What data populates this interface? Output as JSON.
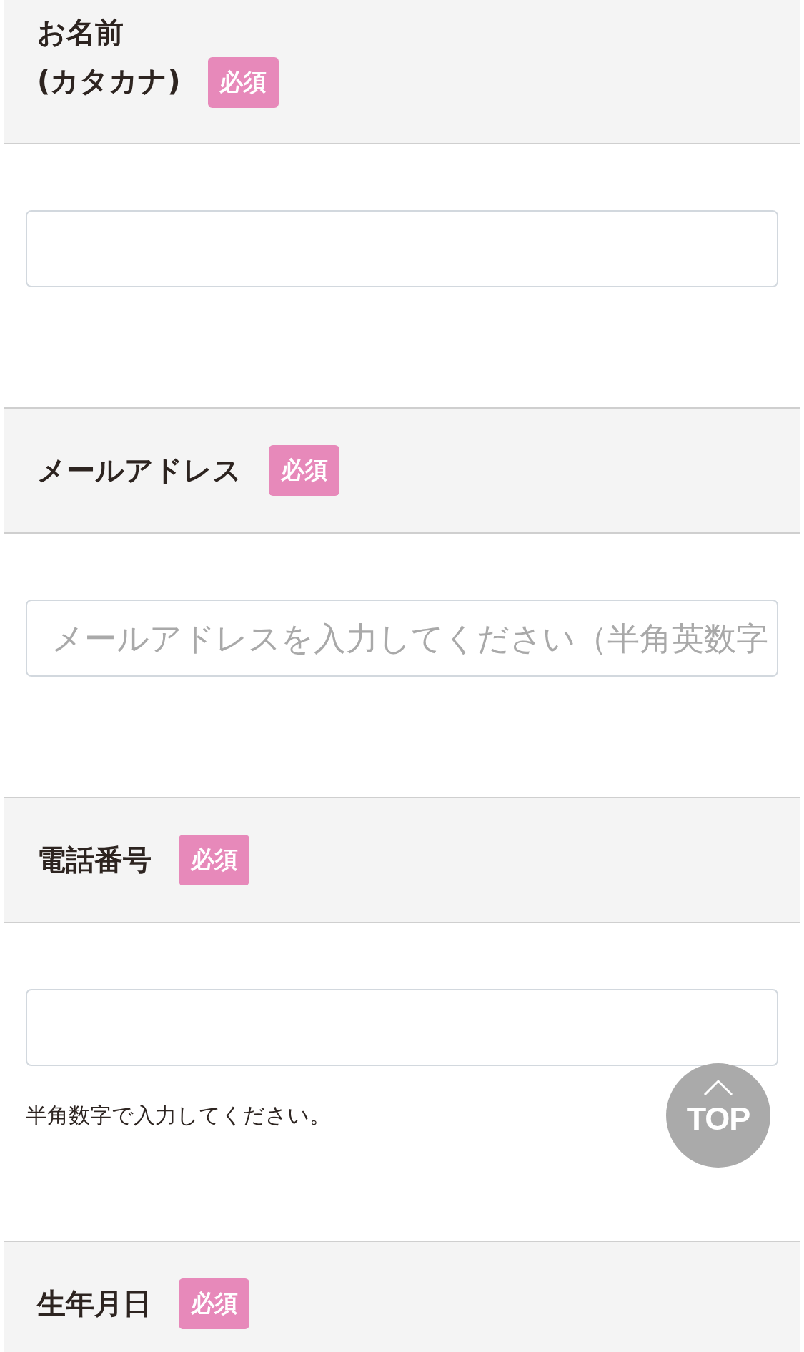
{
  "sections": [
    {
      "kind": "input",
      "label_lines": [
        "お名前",
        "(カタカナ)"
      ],
      "badge": "必須"
    },
    {
      "kind": "input",
      "label_lines": [
        "メールアドレス"
      ],
      "badge": "必須",
      "placeholder": "メールアドレスを入力してください（半角英数字"
    },
    {
      "kind": "input",
      "label_lines": [
        "電話番号"
      ],
      "badge": "必須",
      "helper": "半角数字で入力してください。"
    },
    {
      "kind": "heading",
      "label_lines": [
        "生年月日"
      ],
      "badge": "必須"
    }
  ],
  "top_button": {
    "label": "TOP"
  }
}
